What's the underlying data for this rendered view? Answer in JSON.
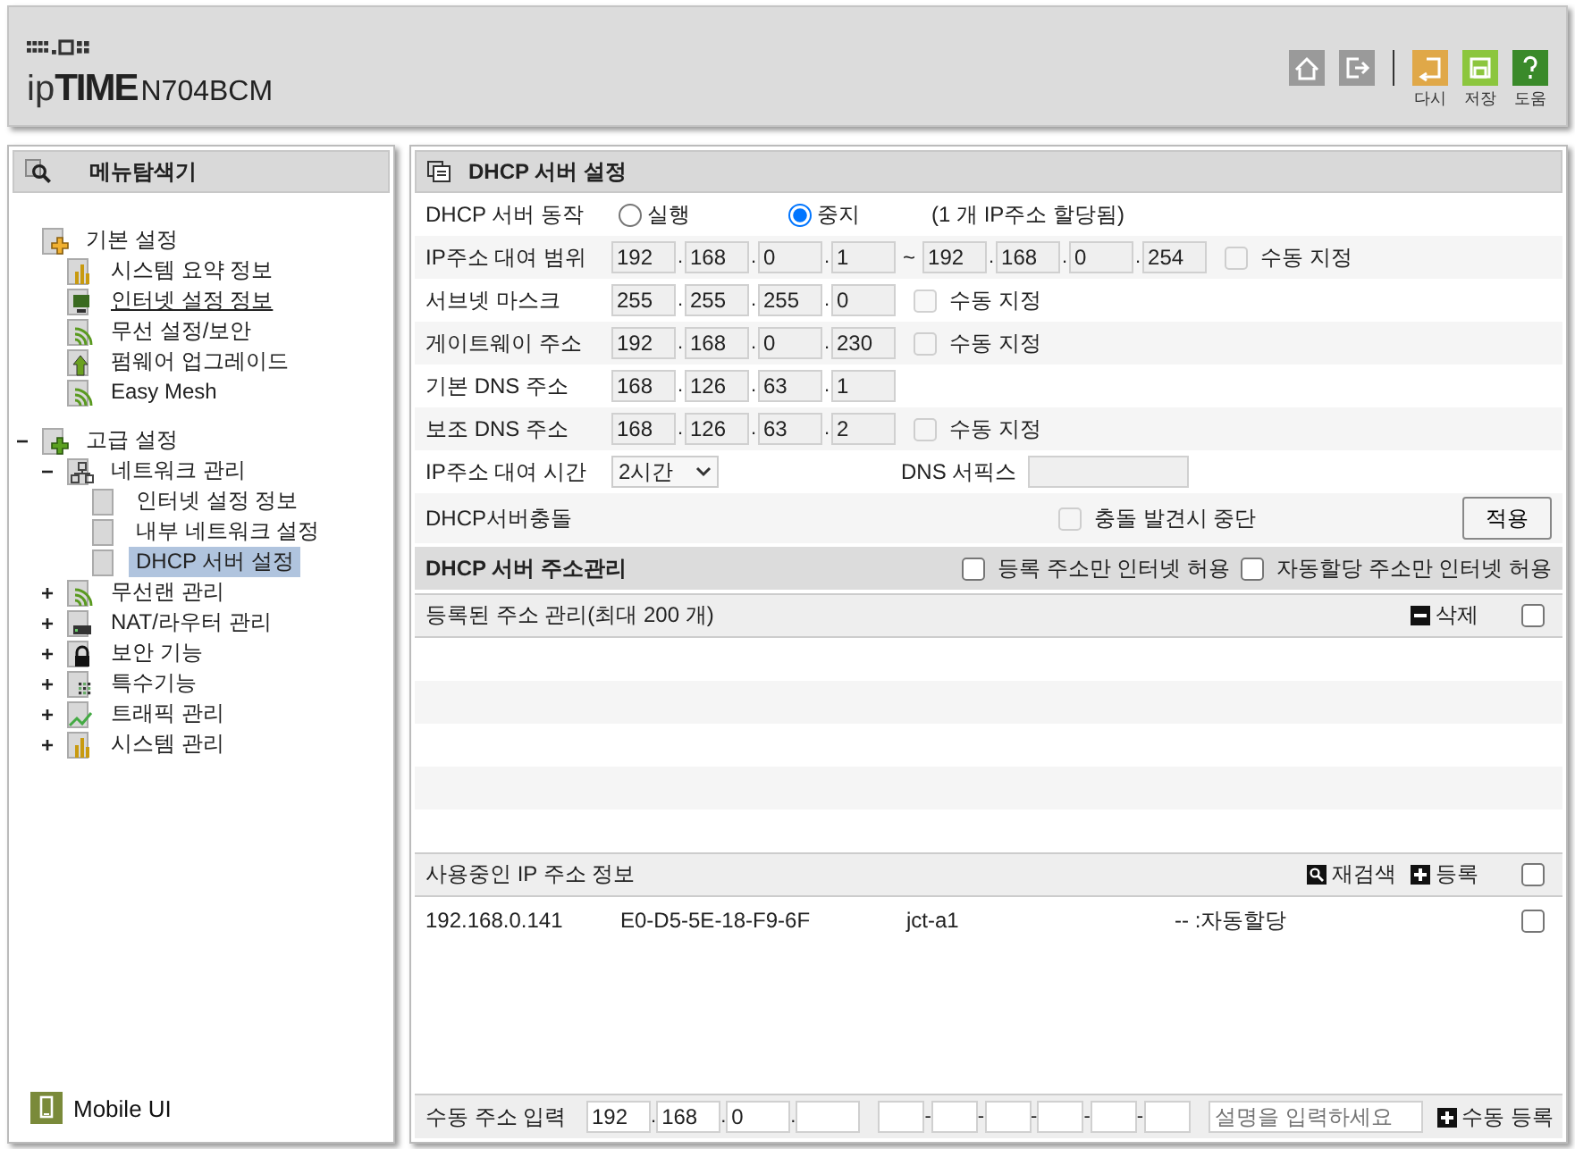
{
  "header": {
    "logo_prefix": "ip",
    "logo_name": "TIME",
    "model": "N704BCM",
    "tools": [
      {
        "kind": "home"
      },
      {
        "kind": "logout"
      },
      {
        "kind": "undo",
        "label": "다시"
      },
      {
        "kind": "save",
        "label": "저장"
      },
      {
        "kind": "help",
        "label": "도움"
      }
    ]
  },
  "menu": {
    "title": "메뉴탐색기",
    "items": [
      {
        "label": "기본 설정",
        "kind": "folder-yellow",
        "selected": false,
        "underlined": false,
        "children": [
          {
            "label": "시스템 요약 정보",
            "kind": "chart",
            "selected": false,
            "underlined": false
          },
          {
            "label": "인터넷 설정 정보",
            "kind": "monitor",
            "selected": false,
            "underlined": true
          },
          {
            "label": "무선 설정/보안",
            "kind": "wifi",
            "selected": false,
            "underlined": false
          },
          {
            "label": "펌웨어 업그레이드",
            "kind": "upload",
            "selected": false,
            "underlined": false
          },
          {
            "label": "Easy Mesh",
            "kind": "wifi",
            "selected": false,
            "underlined": false
          }
        ]
      },
      {
        "marker": "−",
        "label": "고급 설정",
        "kind": "folder-green",
        "selected": false,
        "underlined": false,
        "children": [
          {
            "marker": "−",
            "label": "네트워크 관리",
            "kind": "network",
            "selected": false,
            "underlined": false,
            "children": [
              {
                "label": "인터넷 설정 정보",
                "kind": "page",
                "selected": false,
                "underlined": false
              },
              {
                "label": "내부 네트워크 설정",
                "kind": "page",
                "selected": false,
                "underlined": false
              },
              {
                "label": "DHCP 서버 설정",
                "kind": "page",
                "selected": true,
                "underlined": false
              }
            ]
          },
          {
            "marker": "+",
            "label": "무선랜 관리",
            "kind": "wifi",
            "selected": false,
            "underlined": false
          },
          {
            "marker": "+",
            "label": "NAT/라우터 관리",
            "kind": "router",
            "selected": false,
            "underlined": false
          },
          {
            "marker": "+",
            "label": "보안 기능",
            "kind": "lock",
            "selected": false,
            "underlined": false
          },
          {
            "marker": "+",
            "label": "특수기능",
            "kind": "dots",
            "selected": false,
            "underlined": false
          },
          {
            "marker": "+",
            "label": "트래픽 관리",
            "kind": "traffic",
            "selected": false,
            "underlined": false
          },
          {
            "marker": "+",
            "label": "시스템 관리",
            "kind": "chart",
            "selected": false,
            "underlined": false
          }
        ]
      }
    ],
    "mobile": "Mobile UI"
  },
  "panel": {
    "title": "DHCP 서버 설정",
    "ip_separator": ".",
    "range_separator": "~",
    "rows": [
      {
        "kind": "radio",
        "label": "DHCP 서버 동작",
        "options": [
          {
            "label": "실행",
            "selected": false
          },
          {
            "label": "중지",
            "selected": true
          }
        ],
        "note": "(1 개 IP주소 할당됨)"
      },
      {
        "kind": "ip",
        "label": "IP주소 대여 범위",
        "disabled": true,
        "ip": [
          "192",
          "168",
          "0",
          "1"
        ],
        "ip_end": [
          "192",
          "168",
          "0",
          "254"
        ],
        "manual": {
          "label": "수동 지정",
          "checked": false
        }
      },
      {
        "kind": "ip",
        "label": "서브넷 마스크",
        "disabled": true,
        "ip": [
          "255",
          "255",
          "255",
          "0"
        ],
        "manual": {
          "label": "수동 지정",
          "checked": false
        }
      },
      {
        "kind": "ip",
        "label": "게이트웨이 주소",
        "disabled": true,
        "ip": [
          "192",
          "168",
          "0",
          "230"
        ],
        "manual": {
          "label": "수동 지정",
          "checked": false
        }
      },
      {
        "kind": "ip",
        "label": "기본 DNS 주소",
        "disabled": true,
        "ip": [
          "168",
          "126",
          "63",
          "1"
        ]
      },
      {
        "kind": "ip",
        "label": "보조 DNS 주소",
        "disabled": true,
        "ip": [
          "168",
          "126",
          "63",
          "2"
        ],
        "manual": {
          "label": "수동 지정",
          "checked": false
        }
      },
      {
        "kind": "lease",
        "label": "IP주소 대여 시간",
        "select": "2시간",
        "suffix_label": "DNS 서픽스"
      },
      {
        "kind": "conflict",
        "label": "DHCP서버충돌",
        "option": {
          "label": "충돌 발견시 중단",
          "checked": false
        },
        "button": "적용"
      }
    ],
    "manage": {
      "title": "DHCP 서버 주소관리",
      "options": [
        {
          "label": "등록 주소만 인터넷 허용",
          "checked": false
        },
        {
          "label": "자동할당 주소만 인터넷 허용",
          "checked": false
        }
      ]
    },
    "registered": {
      "title": "등록된 주소 관리(최대 200 개)",
      "delete": "삭제",
      "all_checked": false
    },
    "in_use": {
      "title": "사용중인 IP 주소 정보",
      "rescan": "재검색",
      "register": "등록",
      "all_checked": false,
      "rows": [
        {
          "ip": "192.168.0.141",
          "mac": "E0-D5-5E-18-F9-6F",
          "name": "jct-a1",
          "type": "-- :자동할당",
          "checked": false
        }
      ]
    },
    "manual_entry": {
      "label": "수동 주소 입력",
      "ip": [
        "192",
        "168",
        "0"
      ],
      "mac_separator": "-",
      "placeholder": "설명을 입력하세요",
      "button": "수동 등록"
    }
  }
}
